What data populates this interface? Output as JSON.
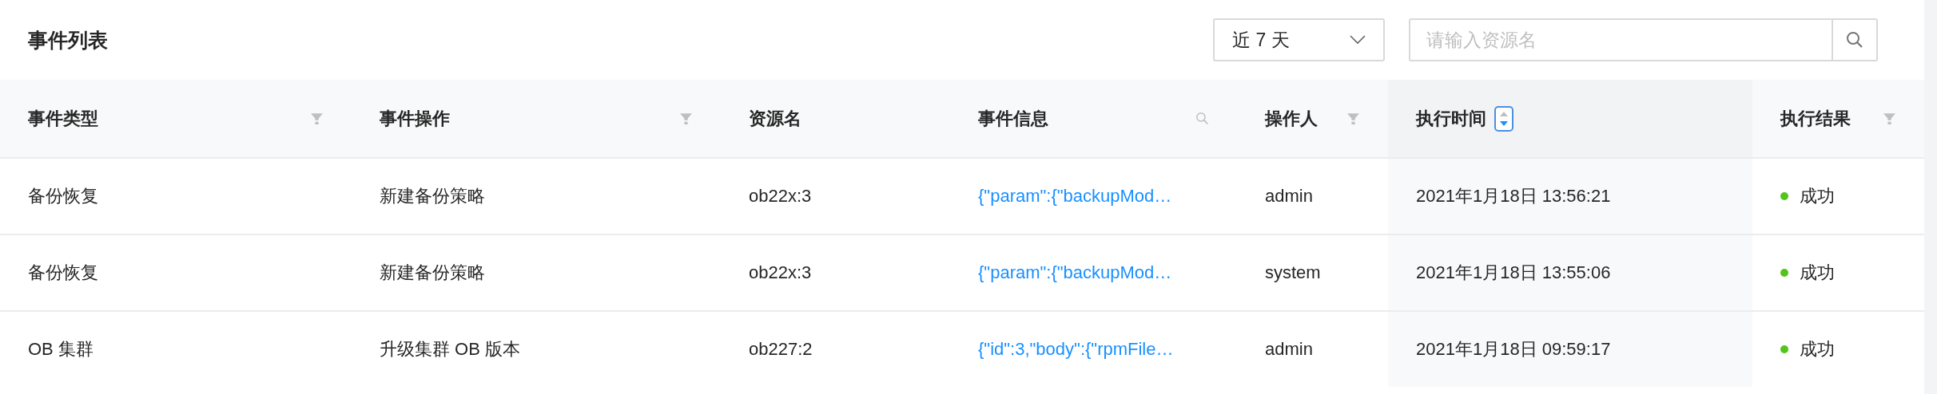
{
  "title": "事件列表",
  "range_select": {
    "value": "近 7 天"
  },
  "search": {
    "placeholder": "请输入资源名"
  },
  "table": {
    "columns": [
      {
        "label": "事件类型",
        "kind": "filter"
      },
      {
        "label": "事件操作",
        "kind": "filter"
      },
      {
        "label": "资源名",
        "kind": "none"
      },
      {
        "label": "事件信息",
        "kind": "search"
      },
      {
        "label": "操作人",
        "kind": "filter"
      },
      {
        "label": "执行时间",
        "kind": "sort",
        "sorted": true,
        "descending": true
      },
      {
        "label": "执行结果",
        "kind": "filter"
      }
    ],
    "rows": [
      {
        "cells": [
          "备份恢复",
          "新建备份策略",
          "ob22x:3",
          "{\"param\":{\"backupMod…",
          "admin",
          "2021年1月18日 13:56:21"
        ],
        "result": {
          "text": "成功",
          "color": "#52c41a"
        }
      },
      {
        "cells": [
          "备份恢复",
          "新建备份策略",
          "ob22x:3",
          "{\"param\":{\"backupMod…",
          "system",
          "2021年1月18日 13:55:06"
        ],
        "result": {
          "text": "成功",
          "color": "#52c41a"
        }
      },
      {
        "cells": [
          "OB 集群",
          "升级集群 OB 版本",
          "ob227:2",
          "{\"id\":3,\"body\":{\"rpmFile…",
          "admin",
          "2021年1月18日 09:59:17"
        ],
        "result": {
          "text": "成功",
          "color": "#52c41a"
        }
      }
    ]
  }
}
